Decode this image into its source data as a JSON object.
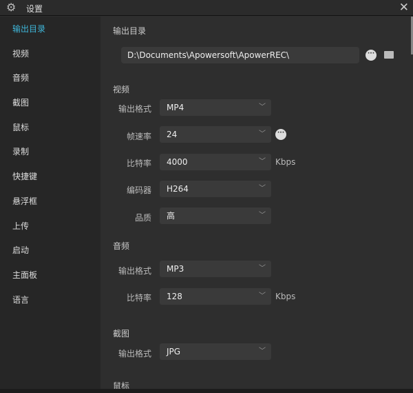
{
  "window": {
    "title": "设置"
  },
  "sidebar": {
    "items": [
      {
        "label": "输出目录"
      },
      {
        "label": "视频"
      },
      {
        "label": "音频"
      },
      {
        "label": "截图"
      },
      {
        "label": "鼠标"
      },
      {
        "label": "录制"
      },
      {
        "label": "快捷键"
      },
      {
        "label": "悬浮框"
      },
      {
        "label": "上传"
      },
      {
        "label": "启动"
      },
      {
        "label": "主面板"
      },
      {
        "label": "语言"
      }
    ]
  },
  "output": {
    "heading": "输出目录",
    "path": "D:\\Documents\\Apowersoft\\ApowerREC\\"
  },
  "video": {
    "heading": "视频",
    "format_label": "输出格式",
    "format": "MP4",
    "fps_label": "帧速率",
    "fps": "24",
    "bitrate_label": "比特率",
    "bitrate": "4000",
    "bitrate_unit": "Kbps",
    "codec_label": "编码器",
    "codec": "H264",
    "quality_label": "品质",
    "quality": "高"
  },
  "audio": {
    "heading": "音频",
    "format_label": "输出格式",
    "format": "MP3",
    "bitrate_label": "比特率",
    "bitrate": "128",
    "bitrate_unit": "Kbps"
  },
  "screenshot": {
    "heading": "截图",
    "format_label": "输出格式",
    "format": "JPG"
  },
  "mouse": {
    "heading": "鼠标"
  },
  "colors": {
    "accent": "#3fb6d9"
  }
}
